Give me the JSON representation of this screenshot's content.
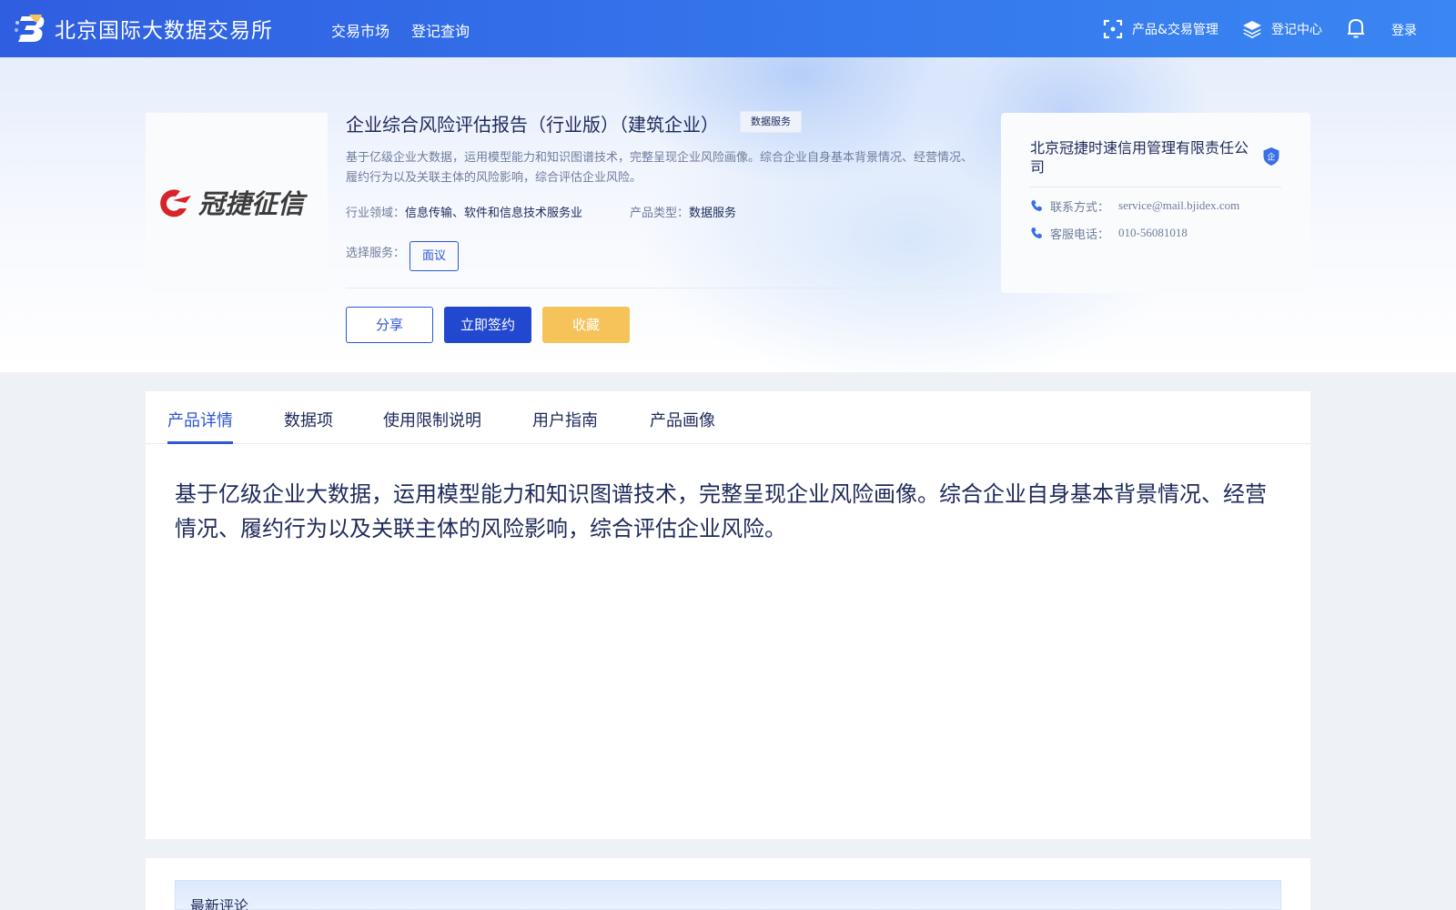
{
  "header": {
    "brand_name": "北京国际大数据交易所",
    "nav": [
      "交易市场",
      "登记查询"
    ],
    "product_mgmt": "产品&交易管理",
    "registry_center": "登记中心",
    "login": "登录"
  },
  "product": {
    "logo_text": "冠捷征信",
    "title": "企业综合风险评估报告（行业版）（建筑企业）",
    "type_badge": "数据服务",
    "description": "基于亿级企业大数据，运用模型能力和知识图谱技术，完整呈现企业风险画像。综合企业自身基本背景情况、经营情况、履约行为以及关联主体的风险影响，综合评估企业风险。",
    "industry_label": "行业领域：",
    "industry_value": "信息传输、软件和信息技术服务业",
    "product_type_label": "产品类型：",
    "product_type_value": "数据服务",
    "service_label": "选择服务：",
    "service_option": "面议",
    "buttons": {
      "share": "分享",
      "sign": "立即签约",
      "favorite": "收藏"
    }
  },
  "company": {
    "name": "北京冠捷时速信用管理有限责任公司",
    "verify_badge": "企",
    "contact_label": "联系方式：",
    "contact_value": "service@mail.bjidex.com",
    "phone_label": "客服电话：",
    "phone_value": "010-56081018"
  },
  "tabs": [
    "产品详情",
    "数据项",
    "使用限制说明",
    "用户指南",
    "产品画像"
  ],
  "detail": {
    "body": "基于亿级企业大数据，运用模型能力和知识图谱技术，完整呈现企业风险画像。综合企业自身基本背景情况、经营情况、履约行为以及关联主体的风险影响，综合评估企业风险。"
  },
  "comments": {
    "title": "最新评论"
  },
  "colors": {
    "header_gradient_start": "#2f5ee0",
    "header_gradient_end": "#3a86f2",
    "primary": "#2d56d3",
    "favorite": "#f5c35a",
    "logo_red": "#d8232a"
  },
  "icons": {
    "brand": "brand-logo-icon",
    "product_mgmt": "scan-icon",
    "registry_center": "layers-icon",
    "notifications": "bell-icon",
    "verify": "shield-icon",
    "contact": "phone-icon"
  }
}
